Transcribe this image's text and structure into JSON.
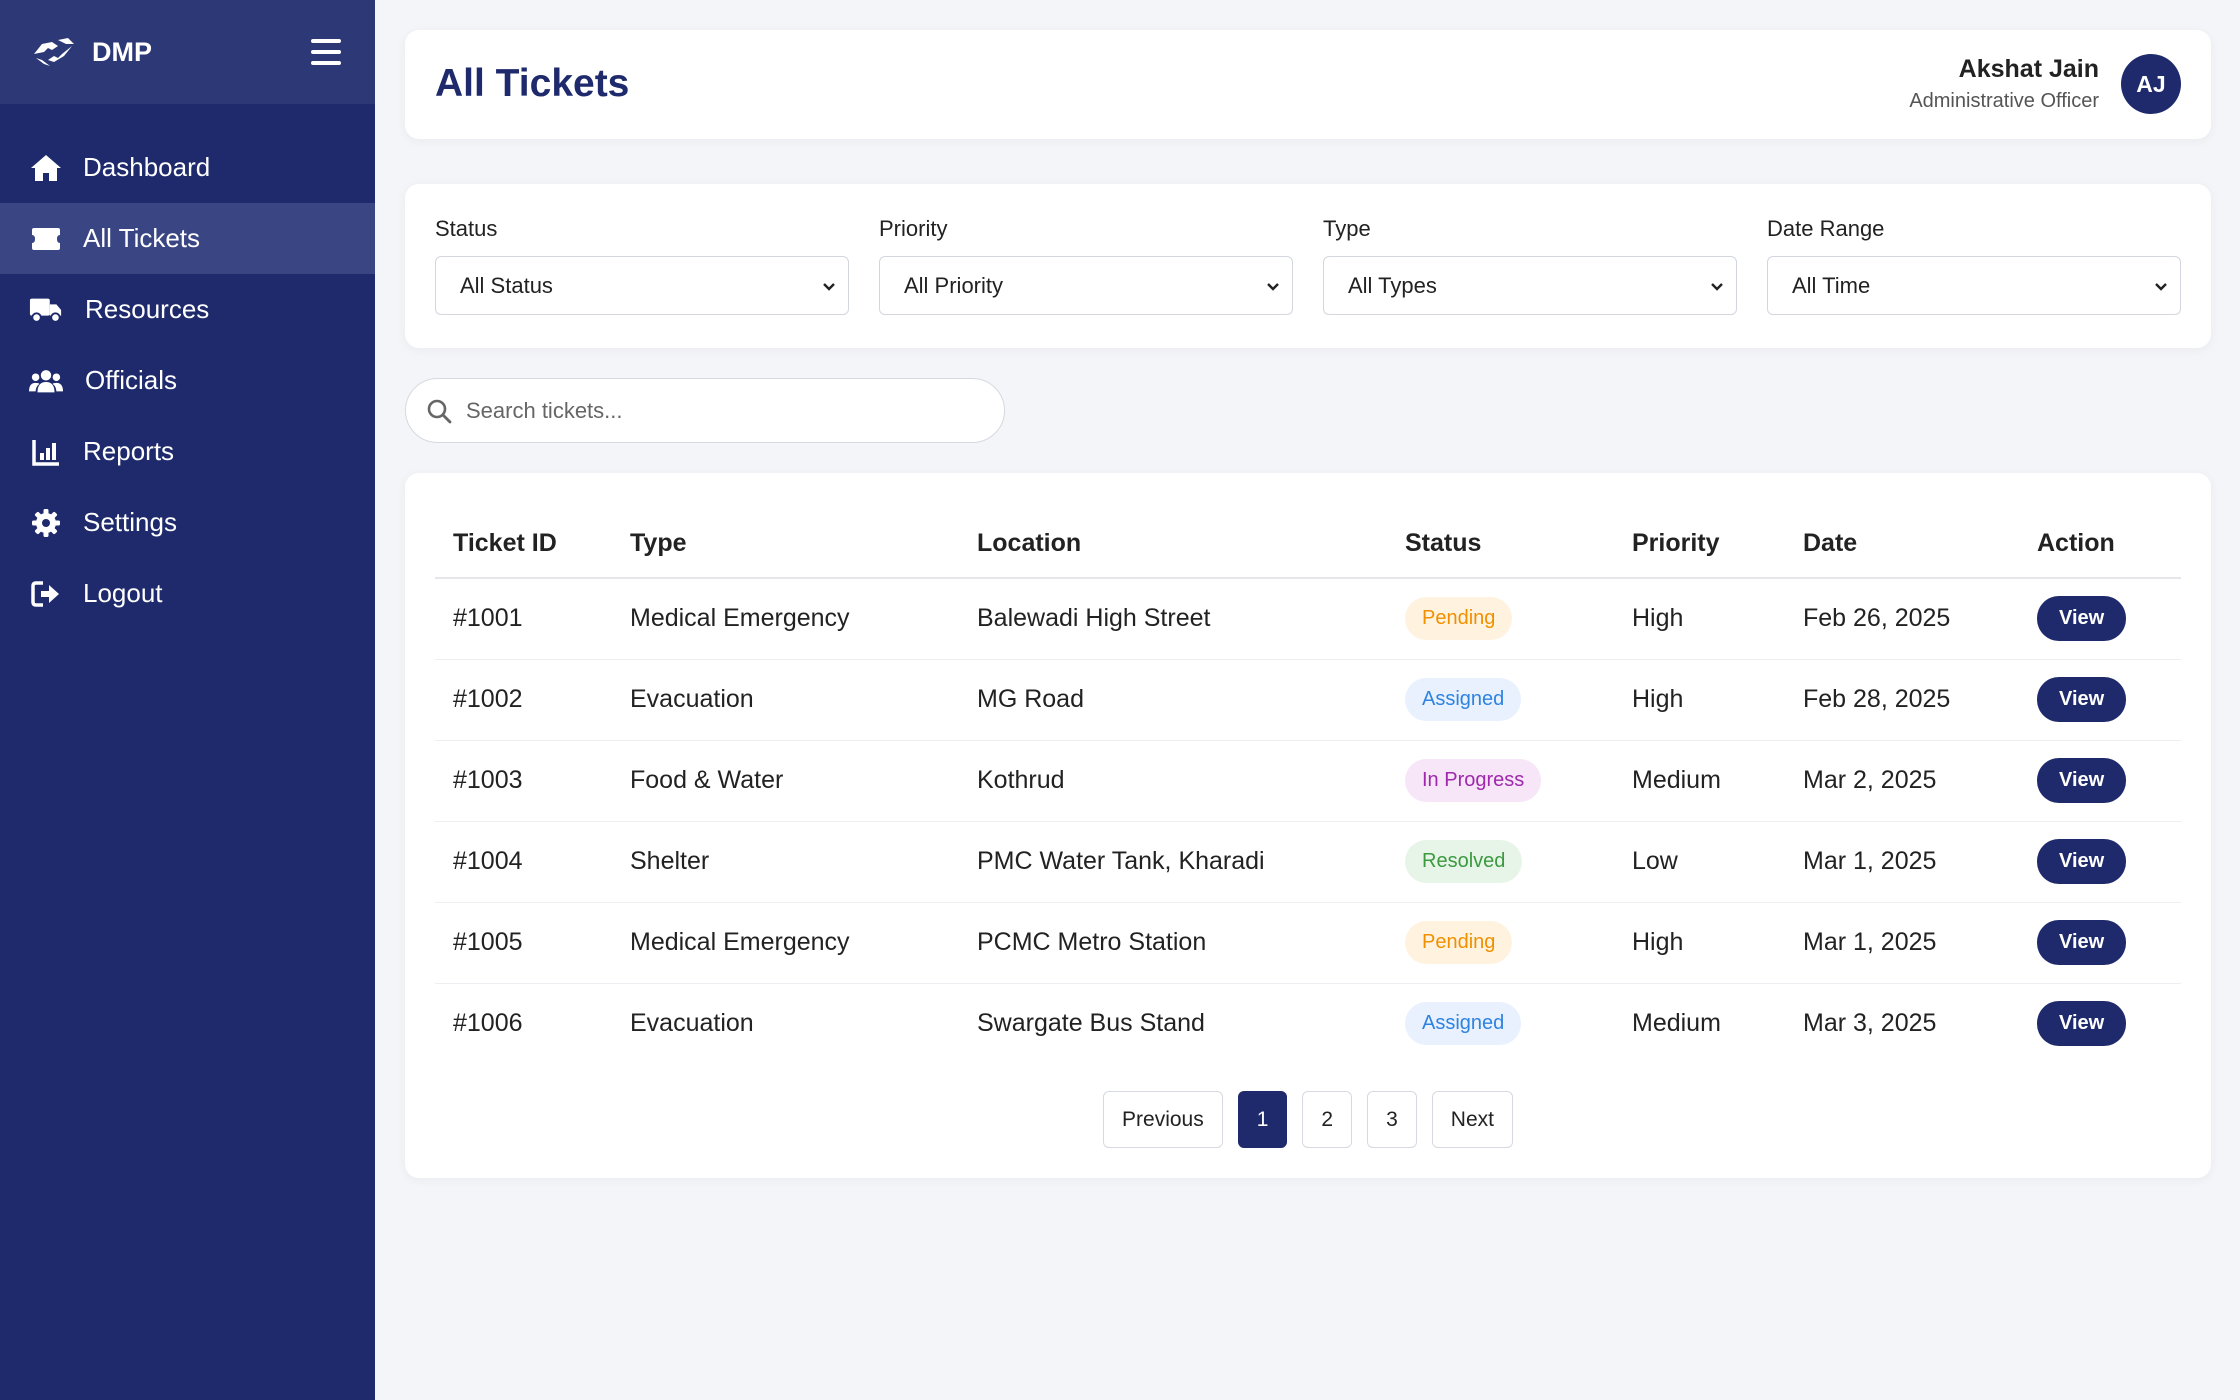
{
  "app": {
    "brand": "DMP"
  },
  "sidebar": {
    "items": [
      {
        "label": "Dashboard",
        "icon": "home-icon"
      },
      {
        "label": "All Tickets",
        "icon": "ticket-icon",
        "active": true
      },
      {
        "label": "Resources",
        "icon": "truck-icon"
      },
      {
        "label": "Officials",
        "icon": "users-icon"
      },
      {
        "label": "Reports",
        "icon": "chart-icon"
      },
      {
        "label": "Settings",
        "icon": "gear-icon"
      },
      {
        "label": "Logout",
        "icon": "logout-icon"
      }
    ]
  },
  "header": {
    "title": "All Tickets",
    "user_name": "Akshat Jain",
    "user_role": "Administrative Officer",
    "avatar_initials": "AJ"
  },
  "filters": [
    {
      "label": "Status",
      "value": "All Status"
    },
    {
      "label": "Priority",
      "value": "All Priority"
    },
    {
      "label": "Type",
      "value": "All Types"
    },
    {
      "label": "Date Range",
      "value": "All Time"
    }
  ],
  "search": {
    "placeholder": "Search tickets..."
  },
  "table": {
    "columns": [
      "Ticket ID",
      "Type",
      "Location",
      "Status",
      "Priority",
      "Date",
      "Action"
    ],
    "rows": [
      {
        "id": "#1001",
        "type": "Medical Emergency",
        "location": "Balewadi High Street",
        "status": "Pending",
        "priority": "High",
        "date": "Feb 26, 2025",
        "action": "View"
      },
      {
        "id": "#1002",
        "type": "Evacuation",
        "location": "MG Road",
        "status": "Assigned",
        "priority": "High",
        "date": "Feb 28, 2025",
        "action": "View"
      },
      {
        "id": "#1003",
        "type": "Food & Water",
        "location": "Kothrud",
        "status": "In Progress",
        "priority": "Medium",
        "date": "Mar 2, 2025",
        "action": "View"
      },
      {
        "id": "#1004",
        "type": "Shelter",
        "location": "PMC Water Tank, Kharadi",
        "status": "Resolved",
        "priority": "Low",
        "date": "Mar 1, 2025",
        "action": "View"
      },
      {
        "id": "#1005",
        "type": "Medical Emergency",
        "location": "PCMC Metro Station",
        "status": "Pending",
        "priority": "High",
        "date": "Mar 1, 2025",
        "action": "View"
      },
      {
        "id": "#1006",
        "type": "Evacuation",
        "location": "Swargate Bus Stand",
        "status": "Assigned",
        "priority": "Medium",
        "date": "Mar 3, 2025",
        "action": "View"
      }
    ]
  },
  "pagination": {
    "previous": "Previous",
    "pages": [
      "1",
      "2",
      "3"
    ],
    "current": "1",
    "next": "Next"
  },
  "colors": {
    "primary": "#1e2a6b",
    "pending": "#f09000",
    "assigned": "#2e83e0",
    "in_progress": "#a028ad",
    "resolved": "#3b9a3f"
  }
}
